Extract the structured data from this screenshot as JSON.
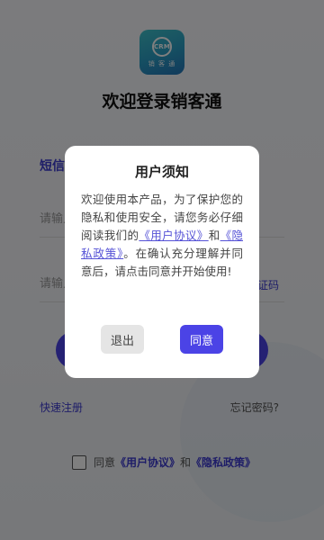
{
  "app": {
    "logo_text": "CRM",
    "logo_subtext": "销 客 通",
    "welcome": "欢迎登录销客通"
  },
  "login": {
    "tab_sms": "短信",
    "phone_placeholder": "请输入",
    "code_placeholder": "请输入",
    "get_code": "证码",
    "quick_register": "快速注册",
    "forgot_password": "忘记密码?",
    "agree_prefix": "同意",
    "user_agreement": "《用户协议》",
    "and": "和",
    "privacy_policy": "《隐私政策》"
  },
  "dialog": {
    "title": "用户须知",
    "body_part1": "欢迎使用本产品，为了保护您的隐私和使用安全，请您务必仔细阅读我们的",
    "link_user_agreement": "《用户协议》",
    "and": "和",
    "link_privacy_policy": "《隐私政策》",
    "body_part2": "。在确认充分理解并同意后，请点击同意并开始使用!",
    "exit_label": "退出",
    "agree_label": "同意"
  },
  "colors": {
    "accent": "#4b43e6",
    "link": "#3d3bd1",
    "logo_gradient_top": "#3fc1c9",
    "logo_gradient_bottom": "#2474b8"
  }
}
